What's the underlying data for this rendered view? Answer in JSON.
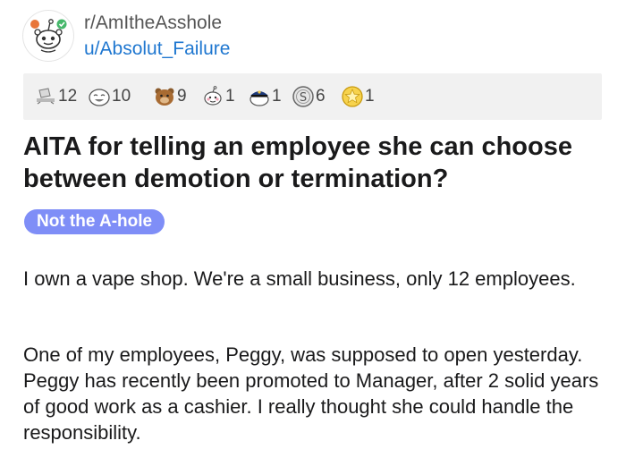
{
  "post": {
    "subreddit": "r/AmItheAsshole",
    "author": "u/Absolut_Failure",
    "title": "AITA for telling an employee she can choose between demotion or termination?",
    "flair": "Not the A-hole",
    "paragraphs": [
      "I own a vape shop. We're a small business, only 12 employees.",
      "One of my employees, Peggy, was supposed to open yesterday. Peggy has recently been promoted to Manager, after 2 solid years of good work as a cashier. I really thought she could handle the responsibility."
    ]
  },
  "awards": [
    {
      "icon": "table-slap-icon",
      "count": "12"
    },
    {
      "icon": "laughing-face-icon",
      "count": "10"
    },
    {
      "icon": "bear-icon",
      "count": "9"
    },
    {
      "icon": "wholesome-icon",
      "count": "1"
    },
    {
      "icon": "police-cap-icon",
      "count": "1"
    },
    {
      "icon": "silver-icon",
      "count": "6"
    },
    {
      "icon": "gold-star-icon",
      "count": "1"
    }
  ],
  "colors": {
    "username": "#1f77d0",
    "flair_bg": "#7f8ef7",
    "awards_bg": "#f1f1f1"
  }
}
